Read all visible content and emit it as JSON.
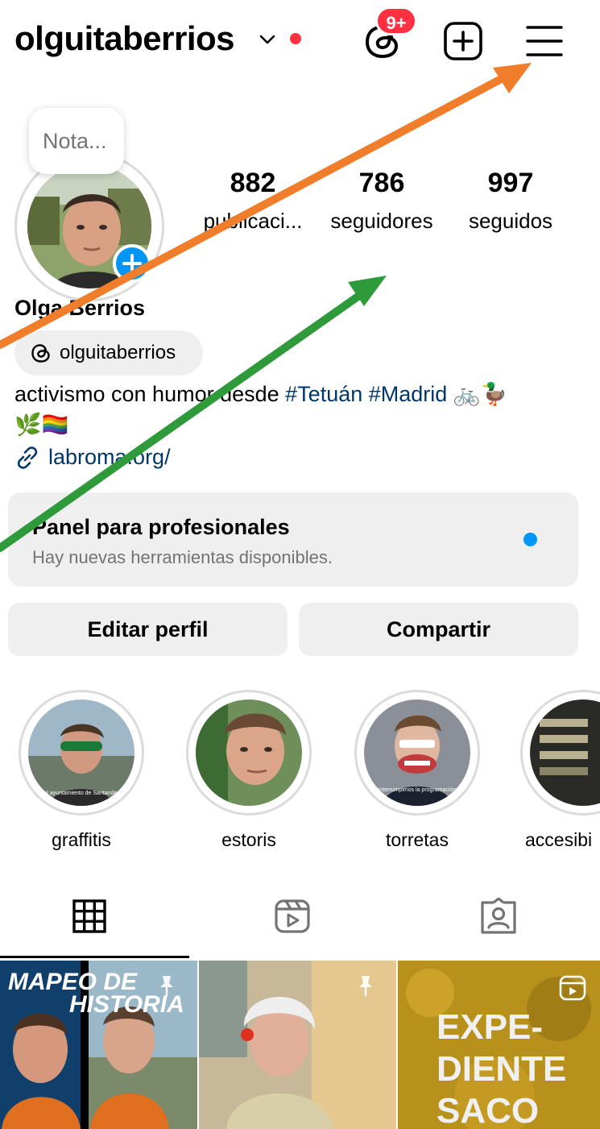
{
  "header": {
    "username": "olguitaberrios",
    "threads_badge": "9+",
    "icons": [
      "chevron-down-icon",
      "threads-icon",
      "add-post-icon",
      "menu-icon"
    ],
    "accent_red": "#ff3040"
  },
  "profile": {
    "note": "Nota...",
    "stats": [
      {
        "value": "882",
        "label": "publicaci..."
      },
      {
        "value": "786",
        "label": "seguidores"
      },
      {
        "value": "997",
        "label": "seguidos"
      }
    ],
    "full_name": "Olga Berrios",
    "threads_handle": "olguitaberrios",
    "bio_text": "activismo con humor desde ",
    "bio_tag1": "#Tetuán",
    "bio_tag2": "#Madrid",
    "bio_emoji_line1": "🚲🦆",
    "bio_emoji_line2": "🌿🏳️‍🌈",
    "link": "labroma.org/",
    "link_color": "#00376b"
  },
  "pro_panel": {
    "title": "Panel para profesionales",
    "subtitle": "Hay nuevas herramientas disponibles.",
    "dot_color": "#0095f6"
  },
  "buttons": {
    "edit": "Editar perfil",
    "share": "Compartir"
  },
  "highlights": [
    {
      "label": "graffitis",
      "caption": "el ayuntamiento de Santander"
    },
    {
      "label": "estoris",
      "caption": ""
    },
    {
      "label": "torretas",
      "caption": "interrumpimos la programación"
    },
    {
      "label": "accesibi",
      "caption": ""
    }
  ],
  "tabs": [
    {
      "icon": "grid-icon",
      "active": true
    },
    {
      "icon": "reels-icon",
      "active": false
    },
    {
      "icon": "tagged-icon",
      "active": false
    }
  ],
  "posts": [
    {
      "title_line1": "MAPEO DE",
      "title_line2": "HISTORIA",
      "pinned": true
    },
    {
      "title_line1": "",
      "title_line2": "",
      "pinned": true
    },
    {
      "title_line1": "EXPE-",
      "title_line2": "DIENTE",
      "title_line3": "SACO",
      "pinned": false,
      "type_icon": "reel-icon"
    }
  ],
  "annotations": {
    "orange": "#f07d2a",
    "green": "#2e9a3a"
  }
}
